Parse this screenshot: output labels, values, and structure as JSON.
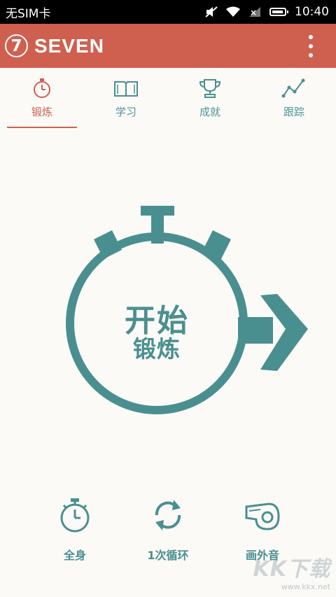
{
  "status_bar": {
    "carrier": "无SIM卡",
    "time": "10:40"
  },
  "app_bar": {
    "logo_digit": "7",
    "title": "SEVEN"
  },
  "tabs": [
    {
      "label": "锻炼",
      "icon": "stopwatch-icon",
      "active": true
    },
    {
      "label": "学习",
      "icon": "book-icon",
      "active": false
    },
    {
      "label": "成就",
      "icon": "trophy-icon",
      "active": false
    },
    {
      "label": "跟踪",
      "icon": "trend-line-icon",
      "active": false
    }
  ],
  "start_button": {
    "line1": "开始",
    "line2": "锻炼"
  },
  "options": [
    {
      "label": "全身",
      "icon": "stopwatch-icon"
    },
    {
      "label": "1次循环",
      "icon": "repeat-icon"
    },
    {
      "label": "画外音",
      "icon": "whistle-icon"
    }
  ],
  "watermark": {
    "brand": "KK下载",
    "url": "www.kkx.net"
  },
  "colors": {
    "accent_red": "#cf604f",
    "teal": "#4a8f90",
    "background": "#fbfaf7"
  }
}
